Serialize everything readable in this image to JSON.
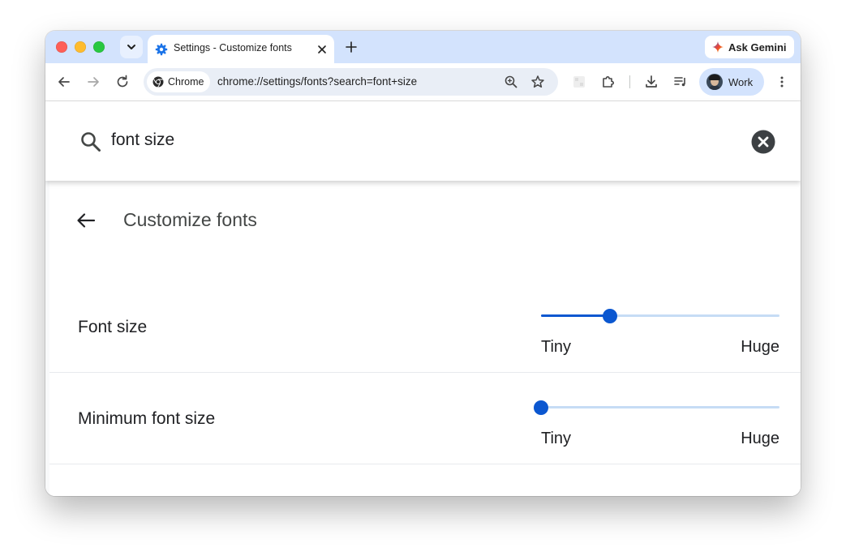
{
  "browser": {
    "tab_title": "Settings - Customize fonts",
    "gemini_label": "Ask Gemini",
    "chip_label": "Chrome",
    "url": "chrome://settings/fonts?search=font+size",
    "profile_label": "Work"
  },
  "search": {
    "query": "font size"
  },
  "page": {
    "title": "Customize fonts"
  },
  "settings": [
    {
      "label": "Font size",
      "min_label": "Tiny",
      "max_label": "Huge",
      "value": 0.29
    },
    {
      "label": "Minimum font size",
      "min_label": "Tiny",
      "max_label": "Huge",
      "value": 0.0
    }
  ],
  "colors": {
    "accent": "#0b57d0",
    "tabstrip": "#d3e3fd",
    "track": "#c6dcf5"
  }
}
